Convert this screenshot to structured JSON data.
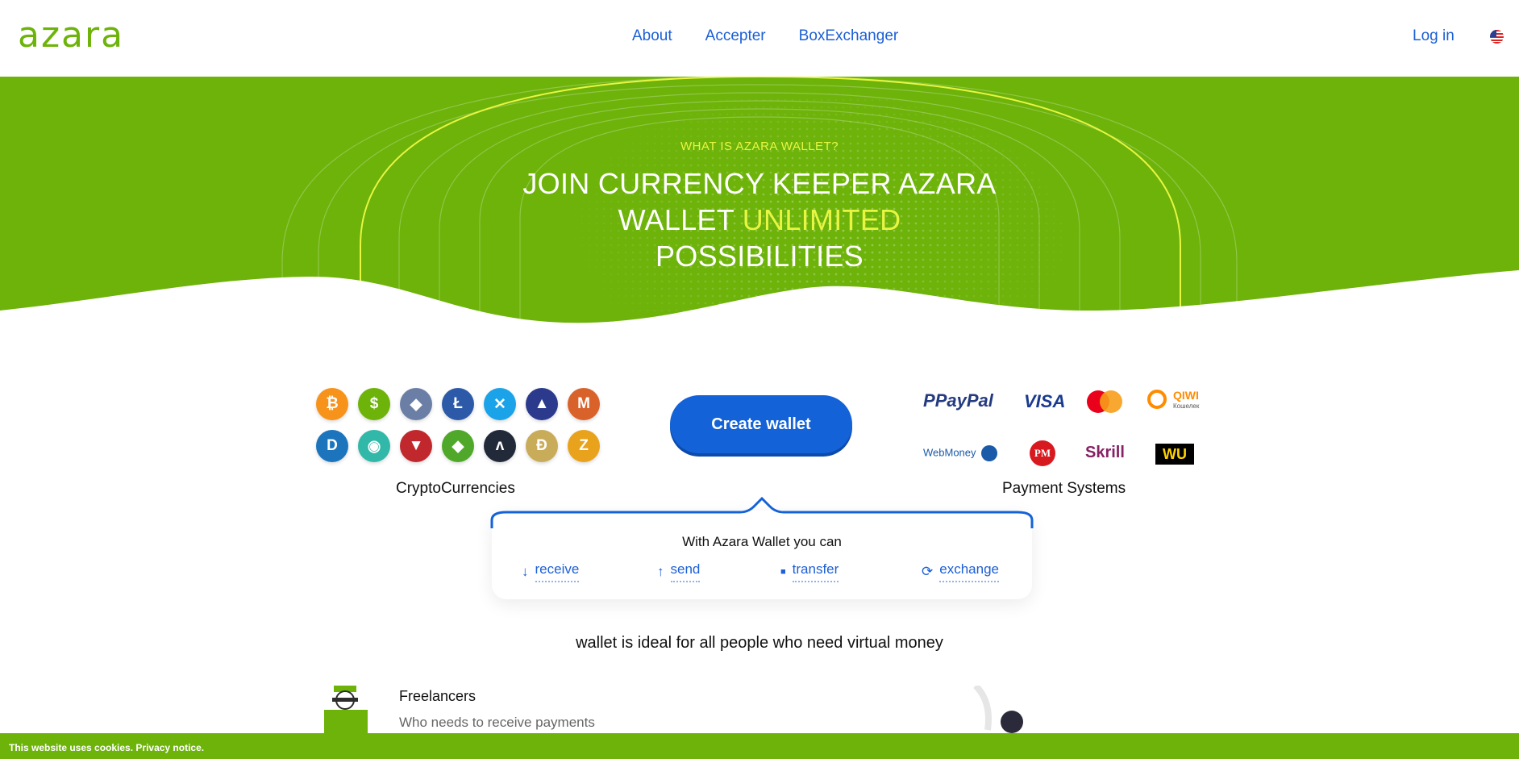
{
  "header": {
    "logo": "azara",
    "nav": [
      "About",
      "Accepter",
      "BoxExchanger"
    ],
    "login": "Log in",
    "flag_icon": "us-flag-icon"
  },
  "hero": {
    "eyebrow": "WHAT IS AZARA WALLET?",
    "title_part1": "JOIN CURRENCY KEEPER AZARA",
    "title_part2": "WALLET ",
    "title_highlight": "UNLIMITED",
    "title_part3": "POSSIBILITIES",
    "colors": {
      "background": "#6db30a",
      "highlight": "#e8f542"
    }
  },
  "crypto": {
    "label": "CryptoCurrencies",
    "coins": [
      {
        "icon": "bitcoin-icon",
        "glyph": "₿",
        "color": "#f7931a"
      },
      {
        "icon": "dollar-coin-icon",
        "glyph": "$",
        "color": "#6db30a"
      },
      {
        "icon": "ethereum-icon",
        "glyph": "◆",
        "color": "#6b7fa6"
      },
      {
        "icon": "litecoin-icon",
        "glyph": "Ł",
        "color": "#2d5aa8"
      },
      {
        "icon": "ripple-icon",
        "glyph": "✕",
        "color": "#1aa3e8"
      },
      {
        "icon": "eos-icon",
        "glyph": "▲",
        "color": "#2b3a8c"
      },
      {
        "icon": "monero-icon",
        "glyph": "M",
        "color": "#d9622b"
      },
      {
        "icon": "dash-icon",
        "glyph": "D",
        "color": "#1c75bc"
      },
      {
        "icon": "nem-icon",
        "glyph": "◉",
        "color": "#31b8a8"
      },
      {
        "icon": "tron-icon",
        "glyph": "▼",
        "color": "#c0282d"
      },
      {
        "icon": "ethereum-classic-icon",
        "glyph": "◆",
        "color": "#4fa82a"
      },
      {
        "icon": "waves-icon",
        "glyph": "ʌ",
        "color": "#222a3a"
      },
      {
        "icon": "dogecoin-icon",
        "glyph": "Ð",
        "color": "#c9ac5a"
      },
      {
        "icon": "zcash-icon",
        "glyph": "Z",
        "color": "#e9a21b"
      }
    ]
  },
  "create_button": "Create wallet",
  "payments": {
    "label": "Payment Systems",
    "row1": [
      "PayPal",
      "VISA",
      "Mastercard",
      "QIWI"
    ],
    "qiwi_sub": "Кошелек",
    "row2": [
      "WebMoney",
      "PM",
      "Skrill",
      "WU"
    ]
  },
  "card": {
    "title": "With Azara Wallet you can",
    "actions": [
      {
        "label": "receive",
        "icon": "arrow-down-icon"
      },
      {
        "label": "send",
        "icon": "arrow-up-icon"
      },
      {
        "label": "transfer",
        "icon": "wallet-icon"
      },
      {
        "label": "exchange",
        "icon": "refresh-icon"
      }
    ]
  },
  "ideal_text": "wallet is ideal for all people who need virtual money",
  "audience": {
    "title": "Freelancers",
    "subtitle": "Who needs to receive payments"
  },
  "cookie": "This website uses cookies. Privacy notice."
}
